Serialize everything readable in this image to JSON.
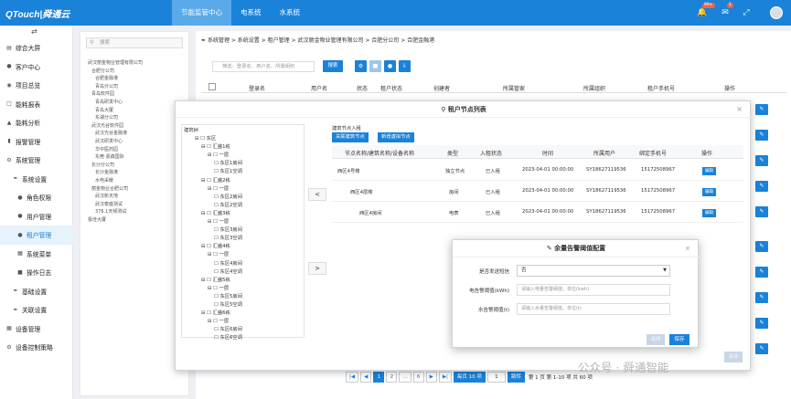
{
  "app": {
    "logo_text": "QTouch|舜通云"
  },
  "topnav": {
    "items": [
      {
        "label": "节能监管中心",
        "active": true
      },
      {
        "label": "电系统",
        "active": false
      },
      {
        "label": "水系统",
        "active": false
      }
    ],
    "notif_badge": "99+",
    "mail_badge": "1"
  },
  "sidebar": {
    "items": [
      {
        "label": "综合大屏",
        "icon": "monitor-icon"
      },
      {
        "label": "客户中心",
        "icon": "person-icon"
      },
      {
        "label": "项目总览",
        "icon": "pin-icon"
      },
      {
        "label": "能耗报表",
        "icon": "report-icon"
      },
      {
        "label": "能耗分析",
        "icon": "analysis-icon"
      },
      {
        "label": "报警管理",
        "icon": "alarm-icon"
      },
      {
        "label": "系统管理",
        "icon": "settings-icon"
      },
      {
        "label": "系统设置",
        "icon": "wrench-icon"
      },
      {
        "label": "角色权限",
        "icon": "role-icon"
      },
      {
        "label": "用户管理",
        "icon": "users-icon"
      },
      {
        "label": "租户管理",
        "icon": "tenant-icon",
        "active": true
      },
      {
        "label": "系统菜单",
        "icon": "menu-icon"
      },
      {
        "label": "操作日志",
        "icon": "log-icon"
      },
      {
        "label": "基础设置",
        "icon": "base-icon"
      },
      {
        "label": "关联设置",
        "icon": "link-icon"
      },
      {
        "label": "设备管理",
        "icon": "device-icon"
      },
      {
        "label": "设备控制策略",
        "icon": "strategy-icon"
      }
    ]
  },
  "left_tree": {
    "search_placeholder": "搜索",
    "nodes": [
      "武汉丽金物业管理有限公司",
      "合肥分公司",
      "合肥金融港",
      "青岛分公司",
      "青岛软件园",
      "青岛研发中心",
      "青岛大厦",
      "东湖分公司",
      "武汉光谷软件园",
      "武汉光谷金融港",
      "武汉研发中心",
      "华中医药园",
      "东莞·嘉森国际",
      "长沙分公司",
      "长沙金融港",
      "水电采暖",
      "丽金物业合肥公司",
      "武汉新天地",
      "武汉泰盛测试",
      "376.1天频测试",
      "极佳大厦"
    ]
  },
  "main": {
    "breadcrumb": "系统管理 > 系统设置 > 租户管理 > 武汉丽金物业管理有限公司 > 合肥分公司 > 合肥金融港",
    "search_placeholder": "筛选：登录名、用户名、所属组织",
    "search_button": "搜索",
    "columns": [
      "登录名",
      "用户名",
      "状态",
      "租户状态",
      "创建者",
      "所属管家",
      "所属组织",
      "租户手机号",
      "操作"
    ]
  },
  "modal": {
    "title": "租户节点列表",
    "left_label": "建筑树",
    "tree": [
      {
        "label": "东区",
        "level": 0
      },
      {
        "label": "汇盛1栋",
        "level": 1
      },
      {
        "label": "一层",
        "level": 2
      },
      {
        "label": "东区1房间",
        "level": 3
      },
      {
        "label": "东区1空调",
        "level": 3
      },
      {
        "label": "汇盛2栋",
        "level": 1
      },
      {
        "label": "一层",
        "level": 2
      },
      {
        "label": "东区2房间",
        "level": 3
      },
      {
        "label": "东区2空调",
        "level": 3
      },
      {
        "label": "汇盛3栋",
        "level": 1
      },
      {
        "label": "一层",
        "level": 2
      },
      {
        "label": "东区3房间",
        "level": 3
      },
      {
        "label": "东区3空调",
        "level": 3
      },
      {
        "label": "汇盛4栋",
        "level": 1
      },
      {
        "label": "一层",
        "level": 2
      },
      {
        "label": "东区4房间",
        "level": 3
      },
      {
        "label": "东区4空调",
        "level": 3
      },
      {
        "label": "汇盛5栋",
        "level": 1
      },
      {
        "label": "一层",
        "level": 2
      },
      {
        "label": "东区5房间",
        "level": 3
      },
      {
        "label": "东区5空调",
        "level": 3
      },
      {
        "label": "汇盛6栋",
        "level": 1
      },
      {
        "label": "一层",
        "level": 2
      },
      {
        "label": "东区6房间",
        "level": 3
      },
      {
        "label": "东区6空调",
        "level": 3
      }
    ],
    "right_label": "建筑节点入租",
    "btn_link": "关联建筑节点",
    "btn_virtual": "新增虚拟节点",
    "columns": [
      "节点名称/建筑名称/设备名称",
      "类型",
      "入租状态",
      "时间",
      "所属用户",
      "绑定手机号",
      "操作"
    ],
    "rows": [
      {
        "name": "西区4号楼",
        "type": "独立节点",
        "status": "已入租",
        "time": "2023-04-01 00:00:00",
        "user": "SY18627119536",
        "phone": "15172508967",
        "action": "编辑"
      },
      {
        "name": "西区4层楼",
        "type": "房间",
        "status": "已入租",
        "time": "2023-04-01 00:00:00",
        "user": "SY18627119536",
        "phone": "15172508967",
        "action": "编辑"
      },
      {
        "name": "西区4房间",
        "type": "电表",
        "status": "已入租",
        "time": "2023-04-01 00:00:00",
        "user": "SY18627119536",
        "phone": "15172508967",
        "action": "编辑"
      }
    ],
    "close_label": "关闭"
  },
  "config": {
    "title": "余量告警阈值配置",
    "sms_label": "是否发送短信",
    "sms_value": "否",
    "elec_label": "电告警阈值(kWh)",
    "elec_placeholder": "请输入电量告警阈值，单位(kwh)",
    "water_label": "水告警阈值(t)",
    "water_placeholder": "请输入水量告警阈值，单位(t)",
    "cancel": "关闭",
    "save": "保存"
  },
  "pager": {
    "pages": [
      "1",
      "2",
      "...",
      "6"
    ],
    "size_label": "每页 10 项",
    "goto_value": "1",
    "goto_label": "跳转",
    "summary": "第 1 页 第 1-10 项 共 60 项"
  },
  "watermark": "公众号 · 舜通智能",
  "colors": {
    "primary": "#1a82d9",
    "topbar": "#1a82d9",
    "sidebar_active_bg": "#e6f2fc"
  }
}
